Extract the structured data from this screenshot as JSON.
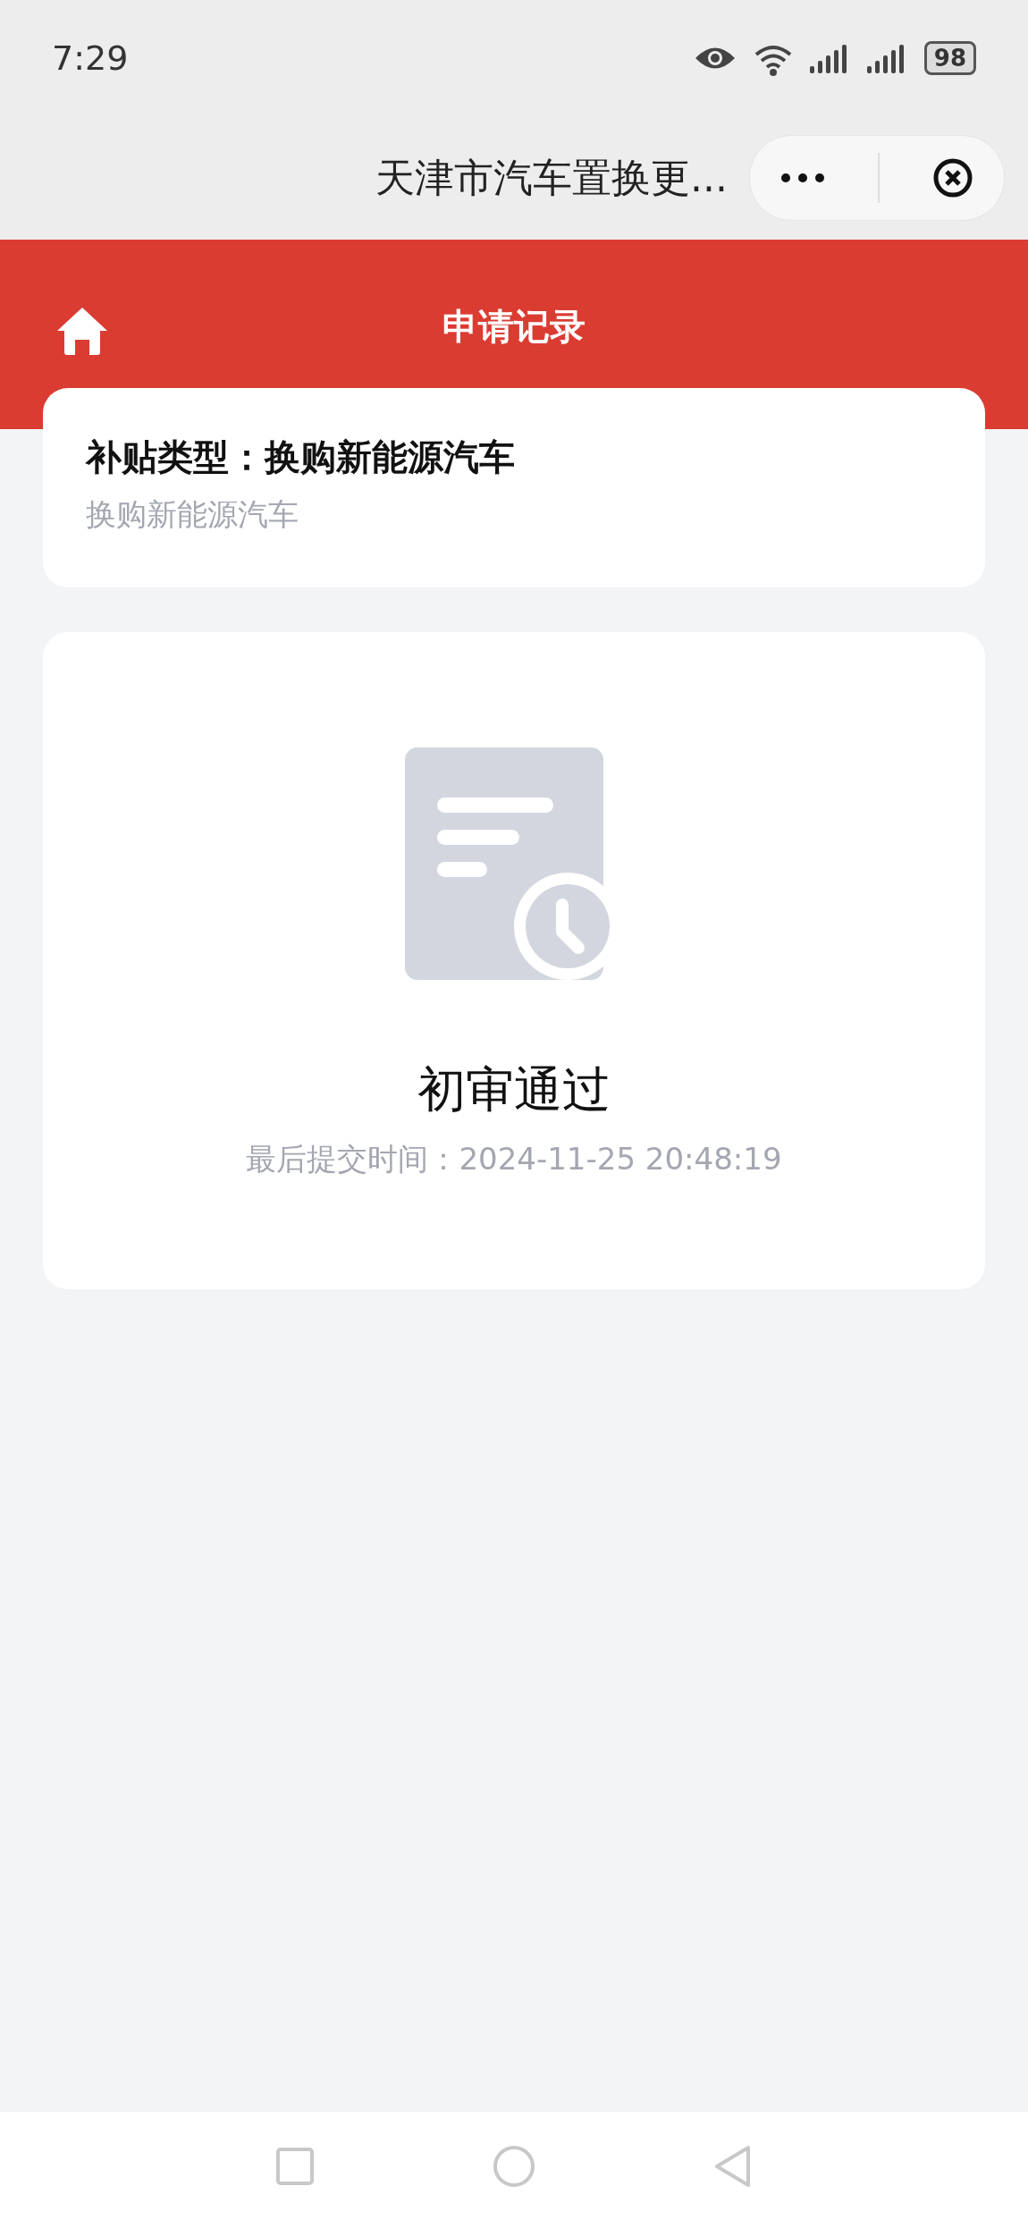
{
  "status_bar": {
    "time": "7:29",
    "battery": "98"
  },
  "mini_program_bar": {
    "title": "天津市汽车置换更..."
  },
  "header": {
    "title": "申请记录"
  },
  "subsidy_card": {
    "title": "补贴类型：换购新能源汽车",
    "subtitle": "换购新能源汽车"
  },
  "status_card": {
    "status": "初审通过",
    "submitted": "最后提交时间：2024-11-25 20:48:19"
  }
}
